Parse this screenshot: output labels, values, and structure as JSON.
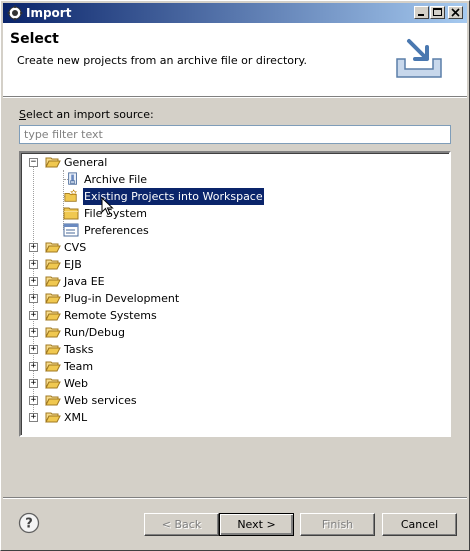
{
  "window": {
    "title": "Import"
  },
  "banner": {
    "title": "Select",
    "description": "Create new projects from an archive file or directory."
  },
  "source": {
    "label_prefix": "S",
    "label_rest": "elect an import source:",
    "filter_placeholder": "type filter text"
  },
  "tree": {
    "general": {
      "label": "General",
      "expanded": true,
      "children": [
        {
          "label": "Archive File",
          "icon": "archive-file-icon"
        },
        {
          "label": "Existing Projects into Workspace",
          "icon": "existing-projects-icon",
          "selected": true
        },
        {
          "label": "File System",
          "icon": "folder-icon"
        },
        {
          "label": "Preferences",
          "icon": "preferences-icon"
        }
      ]
    },
    "categories": [
      "CVS",
      "EJB",
      "Java EE",
      "Plug-in Development",
      "Remote Systems",
      "Run/Debug",
      "Tasks",
      "Team",
      "Web",
      "Web services",
      "XML"
    ]
  },
  "buttons": {
    "back": "< Back",
    "next": "Next >",
    "finish": "Finish",
    "cancel": "Cancel"
  },
  "colors": {
    "selection": "#0a246a",
    "folder": "#f0c850",
    "titlebar": "#0a246a"
  }
}
